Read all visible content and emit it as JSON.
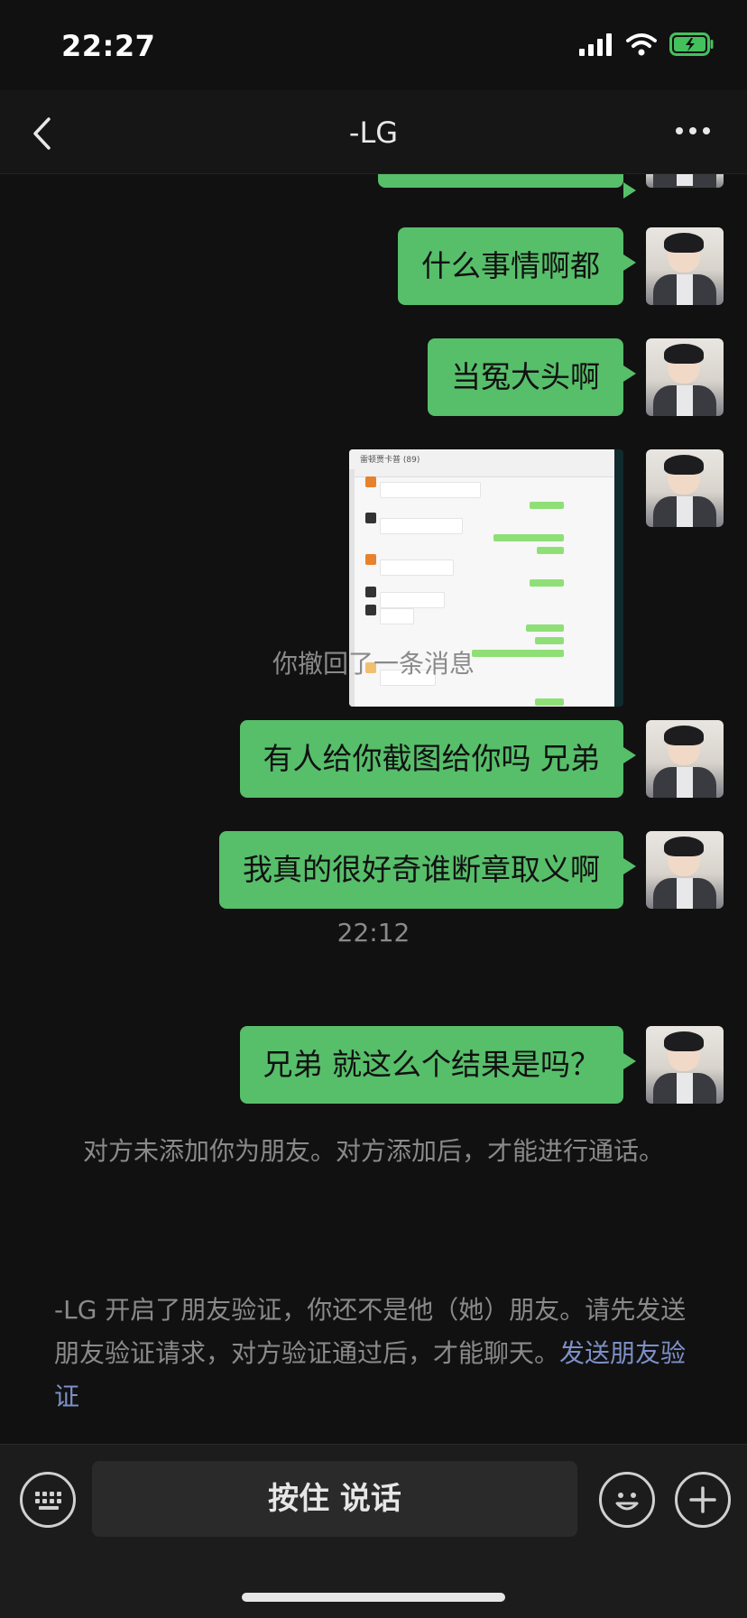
{
  "status_bar": {
    "time": "22:27"
  },
  "header": {
    "title": "-LG"
  },
  "messages": [
    {
      "type": "text",
      "text": "什么事情啊都"
    },
    {
      "type": "text",
      "text": "当冤大头啊"
    },
    {
      "type": "image",
      "preview_title": "雷顿贾卡普 (89)"
    },
    {
      "type": "system",
      "text": "你撤回了一条消息"
    },
    {
      "type": "text",
      "text": "有人给你截图给你吗  兄弟"
    },
    {
      "type": "text",
      "text": "我真的很好奇谁断章取义啊"
    },
    {
      "type": "time",
      "text": "22:12"
    },
    {
      "type": "text",
      "text": "兄弟 就这么个结果是吗？"
    }
  ],
  "notices": {
    "not_friend": "对方未添加你为朋友。对方添加后，才能进行通话。",
    "verify_text": "-LG 开启了朋友验证，你还不是他（她）朋友。请先发送朋友验证请求，对方验证通过后，才能聊天。",
    "verify_link": "发送朋友验证"
  },
  "input_bar": {
    "hold_to_talk": "按住 说话"
  },
  "colors": {
    "bubble": "#57be6a",
    "background": "#111111",
    "link": "#7d90c7"
  },
  "icons": [
    "back-icon",
    "more-icon",
    "keyboard-icon",
    "emoji-icon",
    "plus-icon",
    "signal-icon",
    "wifi-icon",
    "battery-icon"
  ]
}
